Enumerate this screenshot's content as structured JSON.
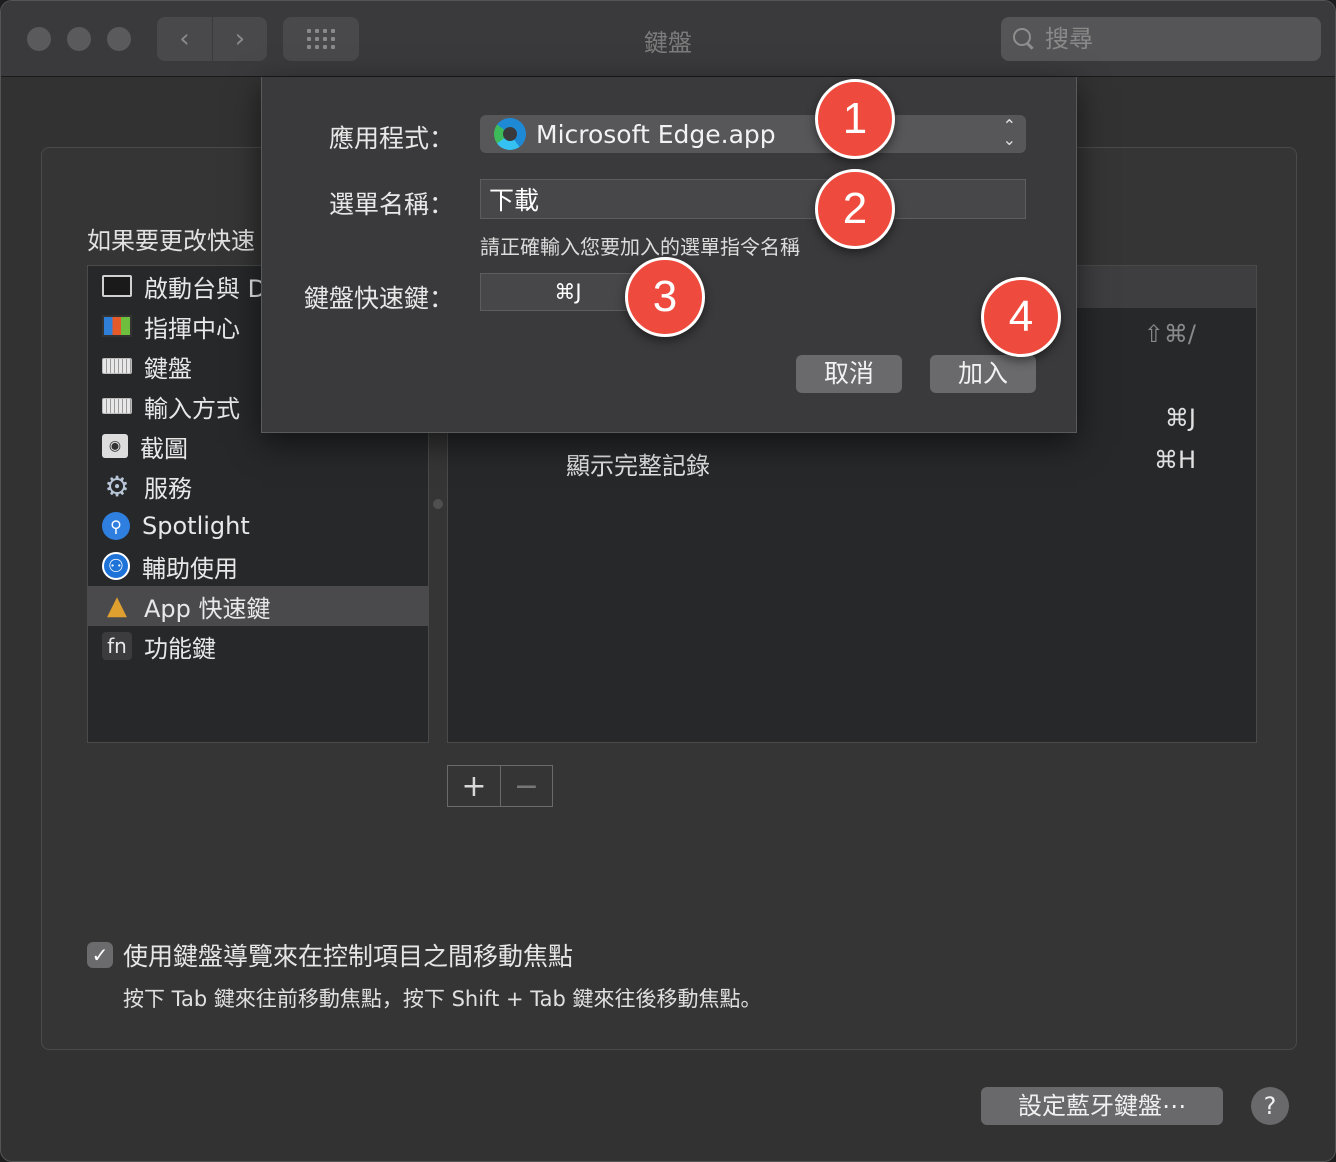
{
  "window": {
    "title": "鍵盤",
    "search_placeholder": "搜尋"
  },
  "instruction": "如果要更改快速",
  "categories": [
    {
      "label": "啟動台與 Dock",
      "icon": "launchpad-icon"
    },
    {
      "label": "指揮中心",
      "icon": "mission-control-icon"
    },
    {
      "label": "鍵盤",
      "icon": "keyboard-icon"
    },
    {
      "label": "輸入方式",
      "icon": "input-source-icon"
    },
    {
      "label": "截圖",
      "icon": "screenshot-icon"
    },
    {
      "label": "服務",
      "icon": "gear-icon"
    },
    {
      "label": "Spotlight",
      "icon": "spotlight-icon"
    },
    {
      "label": "輔助使用",
      "icon": "accessibility-icon"
    },
    {
      "label": "App 快速鍵",
      "icon": "app-shortcuts-icon",
      "selected": true
    },
    {
      "label": "功能鍵",
      "icon": "fn-key-icon"
    }
  ],
  "shortcuts": [
    {
      "name": "",
      "key": "⇧⌘/"
    },
    {
      "name": "",
      "key": "⌘J"
    },
    {
      "name": "顯示完整記錄",
      "key": "⌘H"
    }
  ],
  "buttons": {
    "add": "+",
    "remove": "−",
    "bluetooth": "設定藍牙鍵盤⋯",
    "help": "?"
  },
  "keyboard_nav": {
    "label": "使用鍵盤導覽來在控制項目之間移動焦點",
    "checked": true,
    "hint": "按下 Tab 鍵來往前移動焦點，按下 Shift + Tab 鍵來往後移動焦點。"
  },
  "sheet": {
    "app_label": "應用程式：",
    "app_value": "Microsoft Edge.app",
    "menu_label": "選單名稱：",
    "menu_value": "下載",
    "menu_hint": "請正確輸入您要加入的選單指令名稱",
    "shortcut_label": "鍵盤快速鍵：",
    "shortcut_value": "⌘J",
    "cancel": "取消",
    "add": "加入"
  },
  "markers": [
    "1",
    "2",
    "3",
    "4"
  ]
}
